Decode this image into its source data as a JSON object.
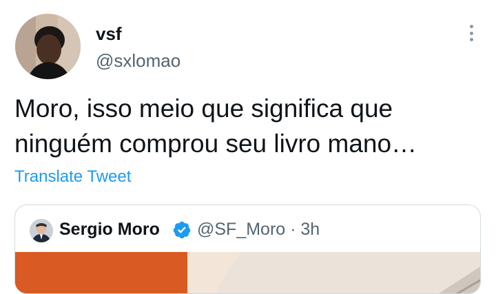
{
  "tweet": {
    "display_name": "vsf",
    "handle": "@sxlomao",
    "text": "Moro, isso meio que significa que ninguém comprou seu livro mano…",
    "translate_label": "Translate Tweet",
    "more_icon": "more-vertical-icon"
  },
  "quoted_tweet": {
    "display_name": "Sergio Moro",
    "verified_icon": "verified-badge-icon",
    "handle_time": "@SF_Moro · 3h"
  },
  "colors": {
    "text": "#0f1419",
    "secondary": "#536471",
    "link": "#1d9bf0",
    "verified": "#1d9bf0",
    "border": "#cfd9de"
  }
}
